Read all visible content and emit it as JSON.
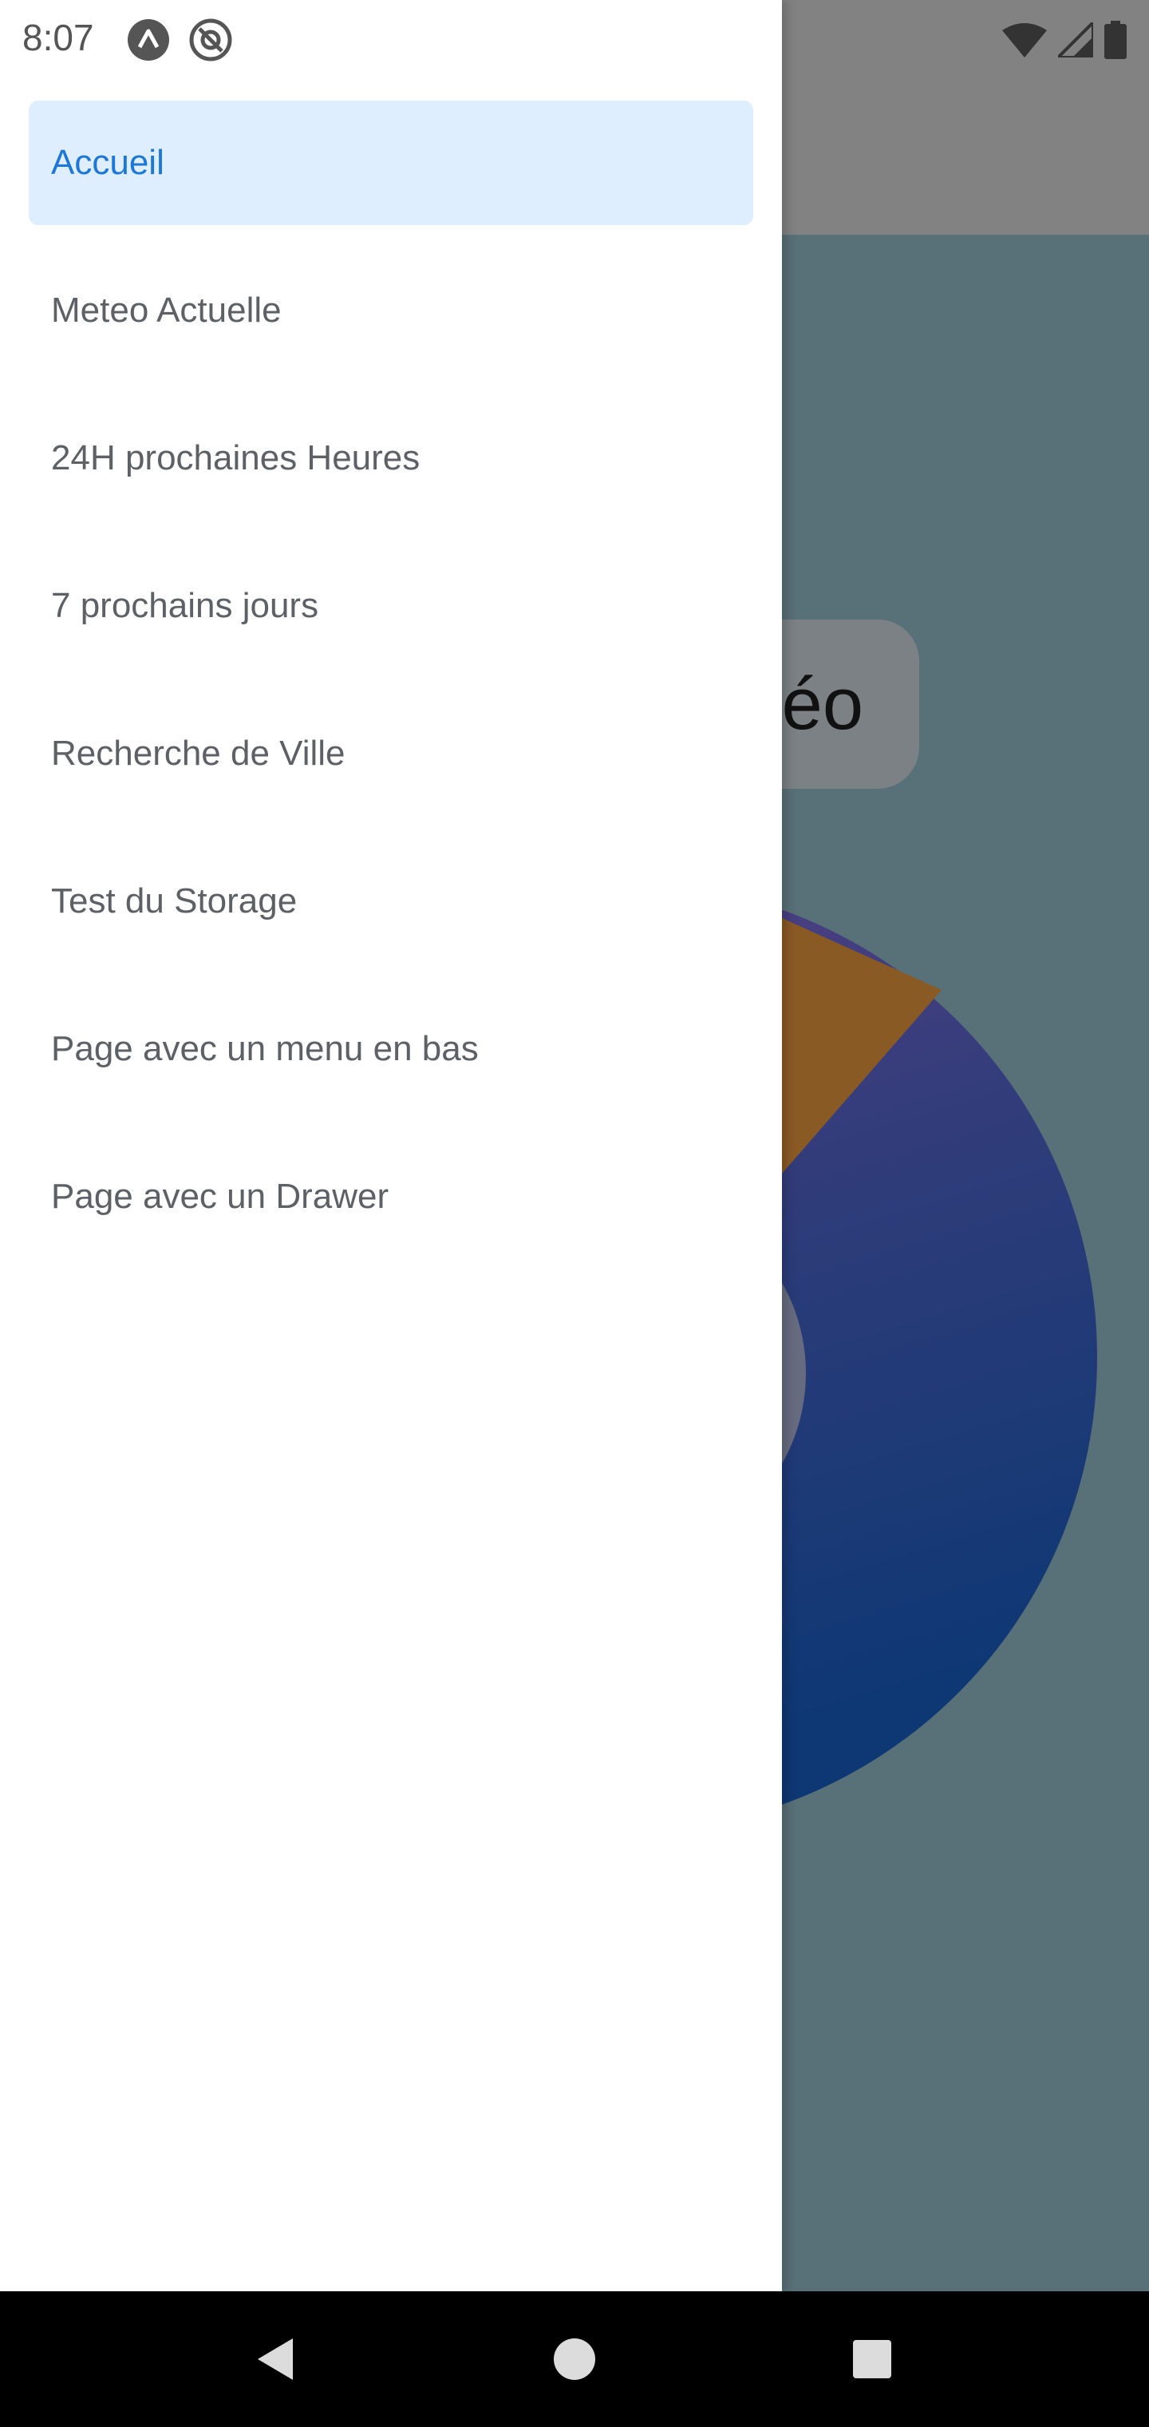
{
  "status_bar": {
    "time": "8:07",
    "left_icons": [
      "expo-icon",
      "at-sign-icon"
    ],
    "right_icons": [
      "wifi-icon",
      "cell-signal-icon",
      "battery-icon"
    ]
  },
  "background_app": {
    "home_button_label": "éo",
    "colors": {
      "overlay": "#587077",
      "header": "#828282",
      "orange": "#8a5a25",
      "purple": "#563e7f",
      "blue": "#123a74"
    }
  },
  "drawer": {
    "items": [
      {
        "label": "Accueil",
        "active": true
      },
      {
        "label": "Meteo Actuelle",
        "active": false
      },
      {
        "label": "24H prochaines Heures",
        "active": false
      },
      {
        "label": "7 prochains jours",
        "active": false
      },
      {
        "label": "Recherche de Ville",
        "active": false
      },
      {
        "label": "Test du Storage",
        "active": false
      },
      {
        "label": "Page avec un menu en bas",
        "active": false
      },
      {
        "label": "Page avec un Drawer",
        "active": false
      }
    ],
    "colors": {
      "active_bg": "#dfeeff",
      "active_text": "#1d77d6",
      "text": "#5d6166"
    }
  },
  "nav_bar": {
    "buttons": [
      "back-icon",
      "home-icon",
      "recents-icon"
    ]
  }
}
